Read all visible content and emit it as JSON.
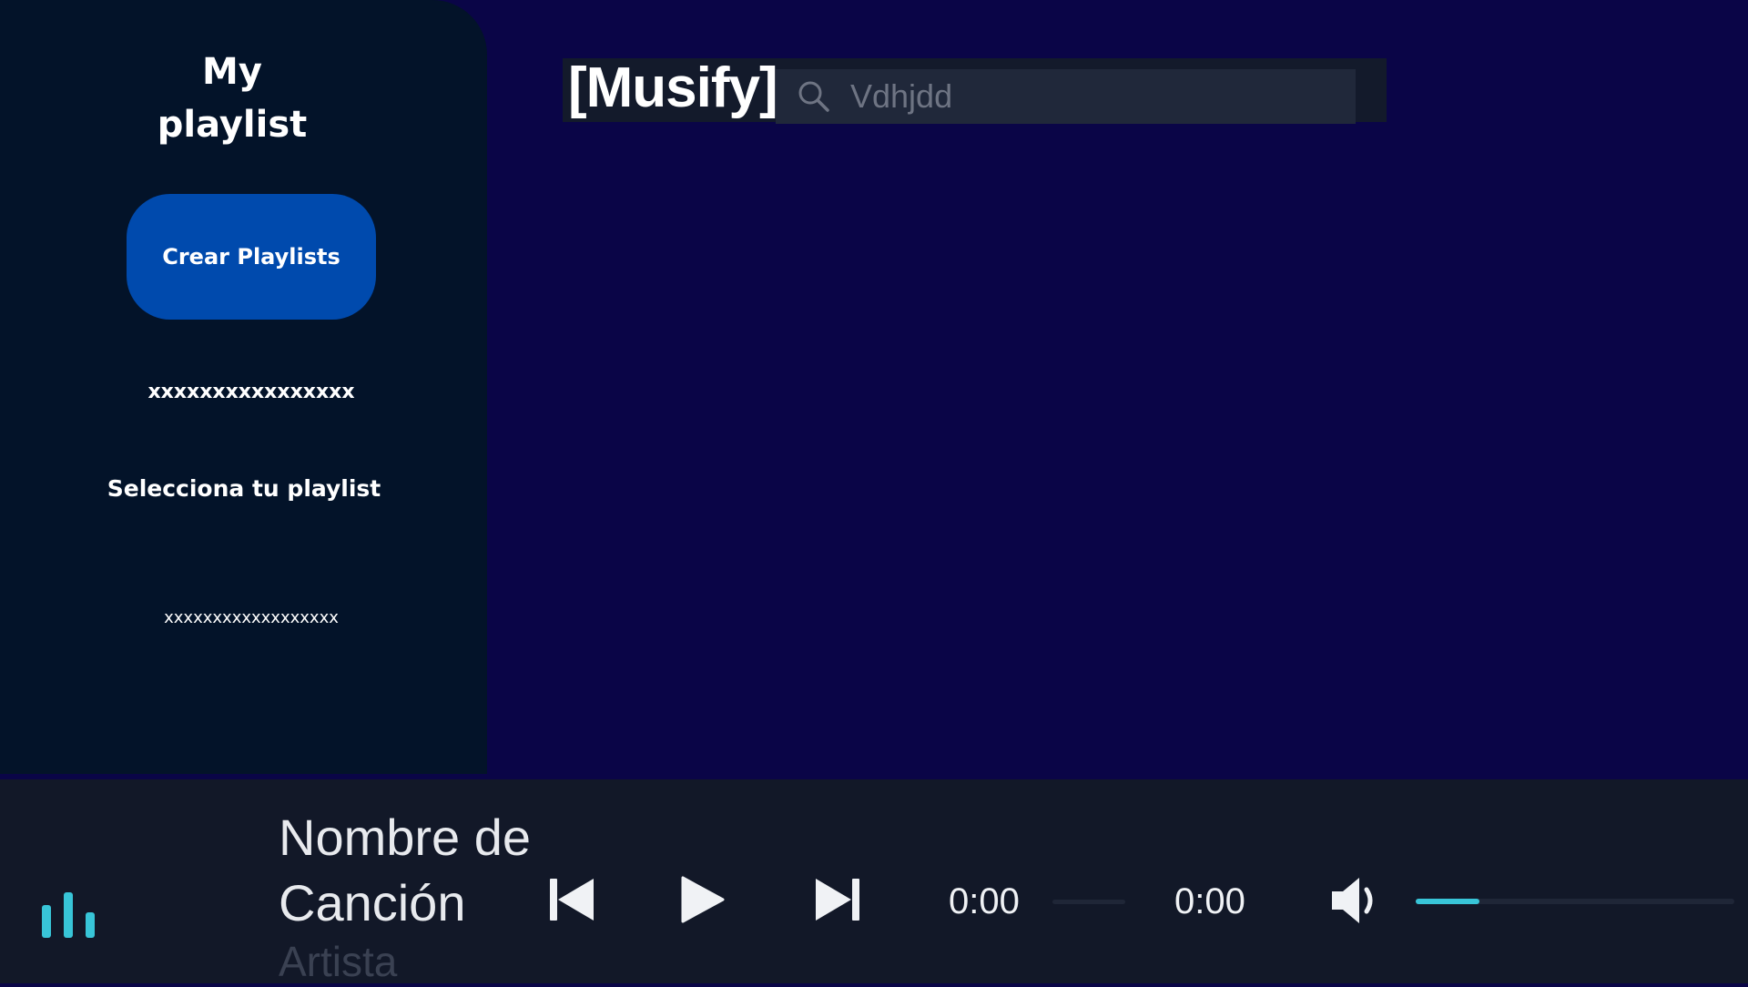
{
  "sidebar": {
    "title_line1": "My",
    "title_line2": "playlist",
    "create_button_label": "Crear Playlists",
    "text_1": "xxxxxxxxxxxxxxxx",
    "text_2": "Selecciona tu playlist",
    "text_3": "xxxxxxxxxxxxxxxxxx"
  },
  "header": {
    "logo": "[Musify]",
    "search_value": "Vdhjdd",
    "search_icon": "search-icon"
  },
  "player": {
    "song_title": "Nombre de Canción",
    "artist": "Artista",
    "time_current": "0:00",
    "time_total": "0:00",
    "progress_fraction": 0,
    "volume_fraction": 0.2,
    "accent_color": "#38c5d8",
    "icons": [
      "equalizer-icon",
      "previous-icon",
      "play-icon",
      "next-icon",
      "volume-icon"
    ]
  },
  "colors": {
    "background": "#0a0547",
    "sidebar": "#031329",
    "button": "#004aad",
    "player_bar": "#121828"
  }
}
